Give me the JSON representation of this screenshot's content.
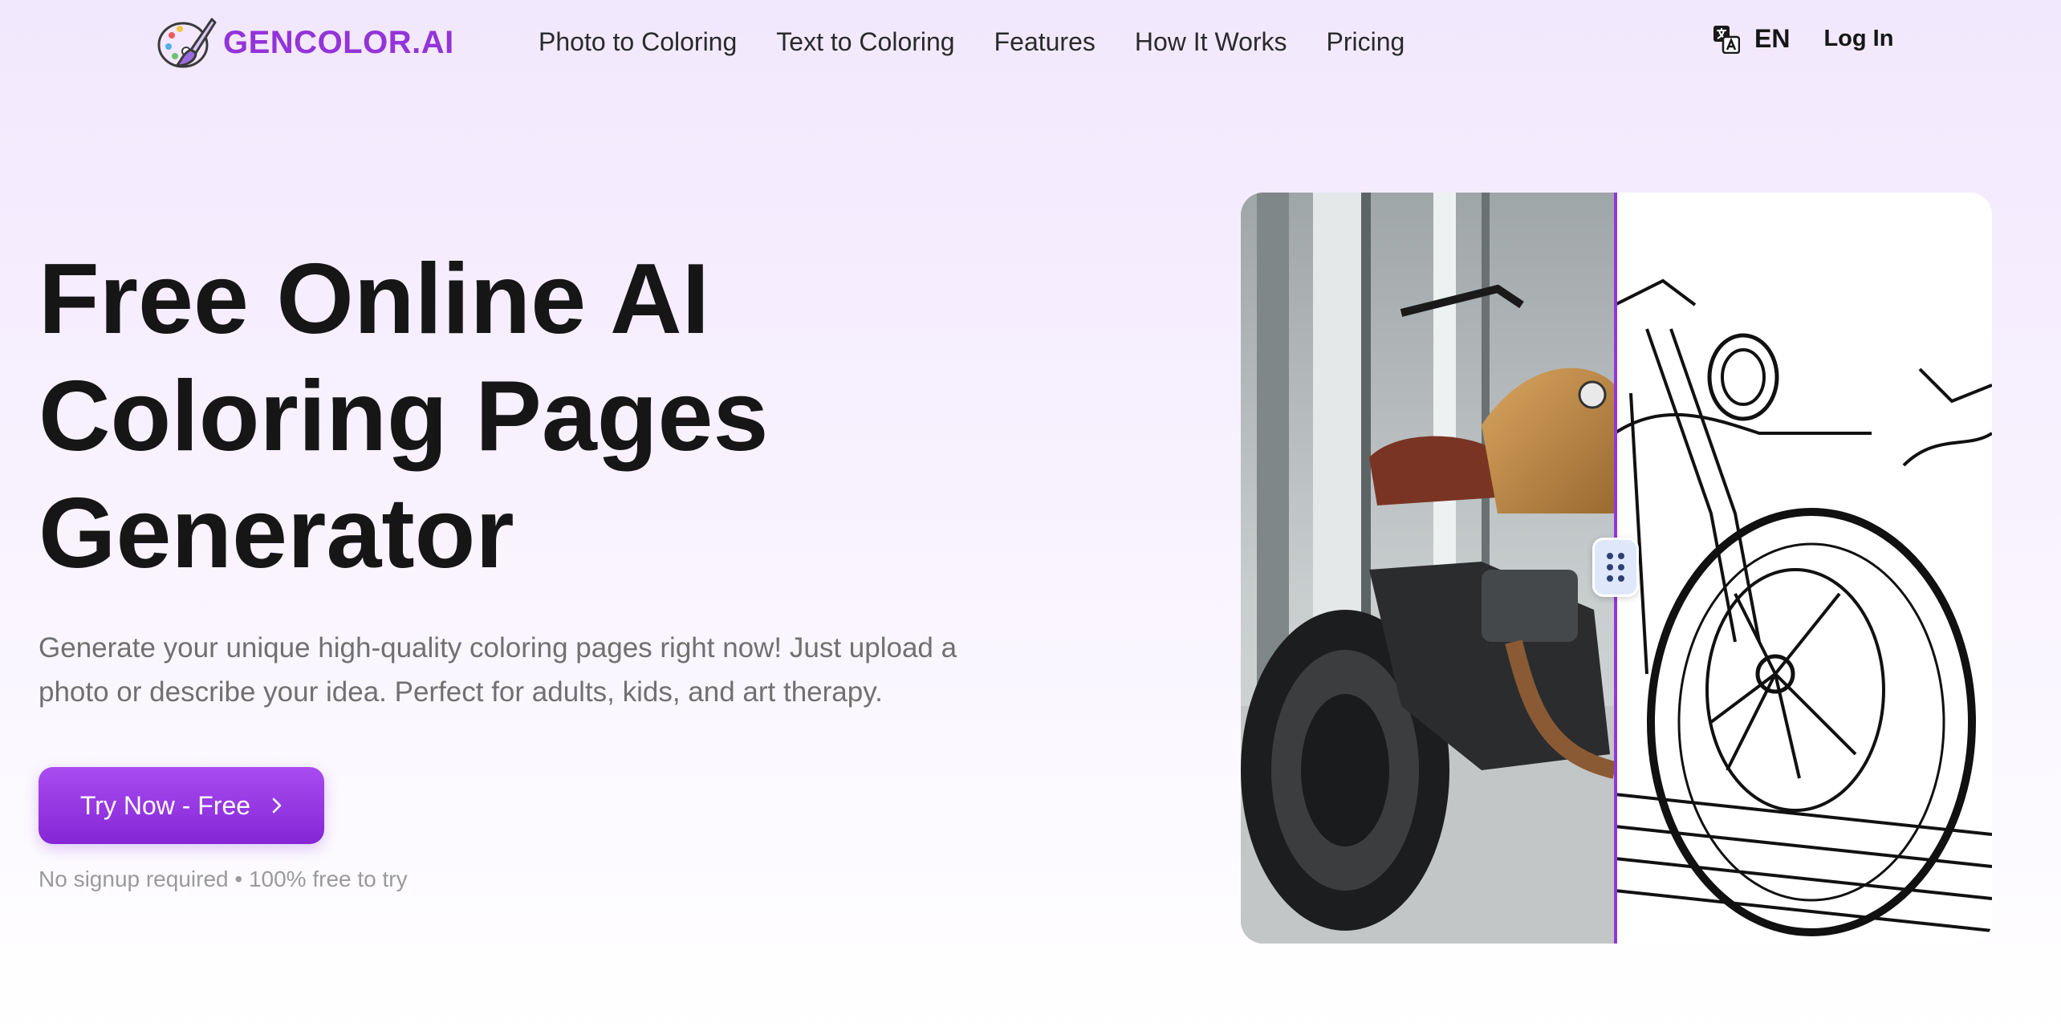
{
  "header": {
    "brand": "GENCOLOR.AI",
    "logo_icon": "palette-brush-icon",
    "nav": [
      "Photo to Coloring",
      "Text to Coloring",
      "Features",
      "How It Works",
      "Pricing"
    ],
    "language_icon": "translate-icon",
    "language": "EN",
    "login_label": "Log In"
  },
  "hero": {
    "title_lines": [
      "Free Online AI",
      "Coloring Pages",
      "Generator"
    ],
    "description": "Generate your unique high-quality coloring pages right now! Just upload a photo or describe your idea. Perfect for adults, kids, and art therapy.",
    "cta_label": "Try Now - Free",
    "cta_icon": "chevron-right-icon",
    "note": "No signup required • 100% free to try"
  },
  "compare": {
    "left_image": "motorcycle-photo",
    "right_image": "motorcycle-coloring-page",
    "handle_icon": "drag-handle-icon",
    "split_position": 0.5
  },
  "colors": {
    "brand": "#9334d8",
    "cta_top": "#a94cf0",
    "cta_bottom": "#8526d6",
    "divider": "#9236dc"
  }
}
